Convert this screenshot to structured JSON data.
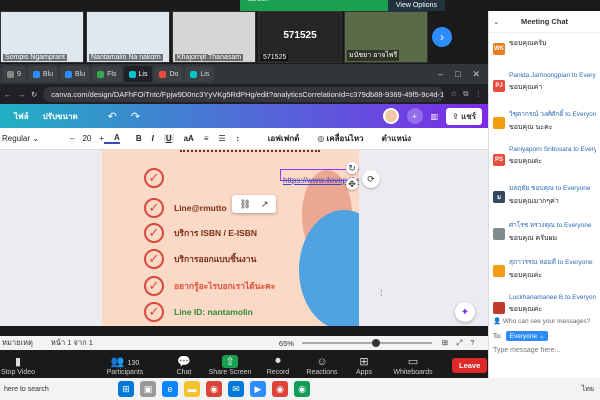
{
  "zoom": {
    "banner": {
      "message": "You are viewing Nantamalin Na nakorn's screen",
      "options": "View Options"
    },
    "participants_video": [
      {
        "name": "Sompis Ngamprarit",
        "tile_text": ""
      },
      {
        "name": "Nantamalin Na nakorn",
        "tile_text": ""
      },
      {
        "name": "Khajornjit Thanasam",
        "tile_text": ""
      },
      {
        "name": "571525",
        "tile_text": "571525"
      },
      {
        "name": "มนัชยา อาจไพรี",
        "tile_text": ""
      }
    ],
    "next_icon": "chevron-right-icon",
    "controls": {
      "stop_video": "Stop Video",
      "participants": "Participants",
      "participants_count": "130",
      "chat": "Chat",
      "share_screen": "Share Screen",
      "record": "Record",
      "reactions": "Reactions",
      "apps": "Apps",
      "whiteboards": "Whiteboards",
      "leave": "Leave"
    }
  },
  "browser": {
    "tabs": [
      "9",
      "Blu",
      "Blu",
      "Fls",
      "Lis",
      "Do",
      "Lis"
    ],
    "url": "canva.com/design/DAFhFOiTntc/Fpjw9D0nc3YyVKg5RdPHg/edit?analyticsCorrelationId=c379db88-9369-49f5-9c4d-18..."
  },
  "canva": {
    "header": {
      "file": "ไฟล์",
      "resize": "ปรับขนาด",
      "share": "แชร์"
    },
    "toolbar": {
      "font": "Regular",
      "minus": "–",
      "size": "20",
      "plus": "+",
      "bold": "B",
      "italic": "I",
      "underline": "U",
      "case": "aA",
      "effects": "เอฟเฟกต์",
      "animate": "เคลื่อนไหว",
      "position": "ตำแหน่ง"
    },
    "slide": {
      "items": [
        {
          "text": "https://www.ilovepdf.com",
          "style": "link"
        },
        {
          "text": "Line@rmutto",
          "style": "dark"
        },
        {
          "text": "บริการ ISBN / E-ISBN",
          "style": "dark"
        },
        {
          "text": "บริการออกแบบชิ้นงาน",
          "style": "dark"
        },
        {
          "text": "อยากรู้อะไรบอกเราได้นะคะ",
          "style": "pink"
        },
        {
          "text": "Line ID: nantamolin",
          "style": "green"
        }
      ]
    },
    "footer": {
      "notes": "หมายเหตุ",
      "page": "หน้า 1 จาก 1",
      "zoom": "65%"
    }
  },
  "chat": {
    "title": "Meeting Chat",
    "messages": [
      {
        "initials": "WK",
        "color": "#e67e22",
        "from": "",
        "text": "ขอบคุณครับ"
      },
      {
        "initials": "PJ",
        "color": "#e74c3c",
        "from": "Panida Jamnongpian to Everyone",
        "text": "ขอบคุณค่า"
      },
      {
        "initials": "",
        "color": "#f39c12",
        "from": "วิชุดากรณ์ วงศ์ศักดิ์ to Everyone",
        "text": "ขอบคุณ นะคะ"
      },
      {
        "initials": "PS",
        "color": "#e74c3c",
        "from": "Paniyaporn Sribusara to Everyone",
        "text": "ขอบคุณค่ะ"
      },
      {
        "initials": "ม",
        "color": "#34495e",
        "from": "มลฤทัย ขอบคุณ to Everyone",
        "text": "ขอบคุณมากๆค่า"
      },
      {
        "initials": "",
        "color": "#7f8c8d",
        "from": "ศาโรช ทรวงคุณ to Everyone",
        "text": "ขอบคุณ ครับผม"
      },
      {
        "initials": "",
        "color": "#f39c12",
        "from": "สุภาวรรณ หอมดี to Everyone",
        "text": "ขอบคุณค่ะ"
      },
      {
        "initials": "",
        "color": "#c0392b",
        "from": "Luckhanamanee B to Everyone",
        "text": "ขอบคุณค่ะ"
      }
    ],
    "who_can_see": "Who can see your messages?",
    "to_label": "To:",
    "recipient": "Everyone",
    "placeholder": "Type message here..."
  },
  "taskbar": {
    "search": "here to search",
    "lang": "ไทย"
  }
}
